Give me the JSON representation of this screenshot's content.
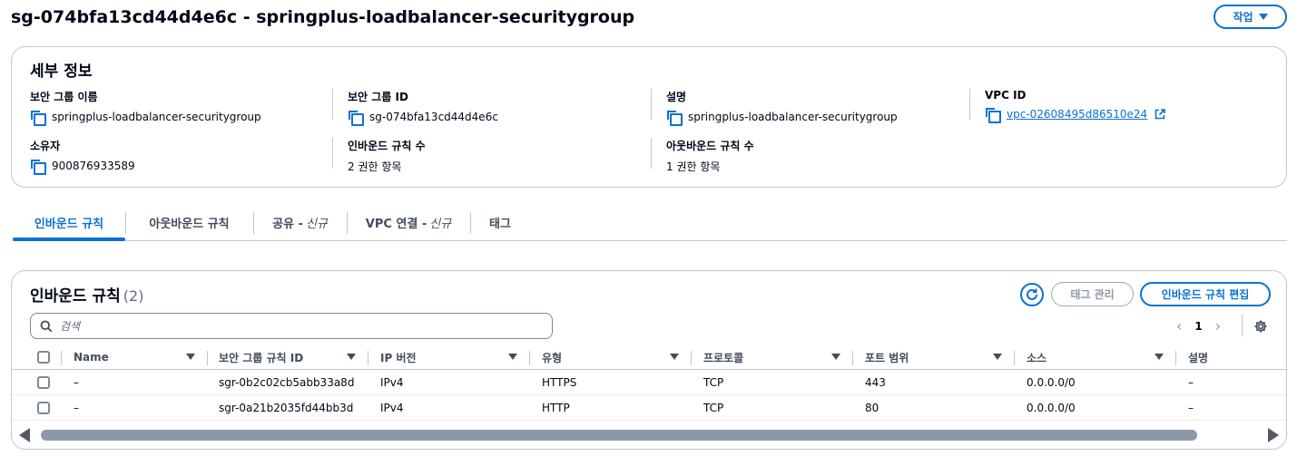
{
  "header": {
    "title": "sg-074bfa13cd44d4e6c - springplus-loadbalancer-securitygroup",
    "actions_label": "작업"
  },
  "details": {
    "title": "세부 정보",
    "security_group_name": {
      "label": "보안 그룹 이름",
      "value": "springplus-loadbalancer-securitygroup"
    },
    "security_group_id": {
      "label": "보안 그룹 ID",
      "value": "sg-074bfa13cd44d4e6c"
    },
    "description": {
      "label": "설명",
      "value": "springplus-loadbalancer-securitygroup"
    },
    "vpc_id": {
      "label": "VPC ID",
      "value": "vpc-02608495d86510e24"
    },
    "owner": {
      "label": "소유자",
      "value": "900876933589"
    },
    "inbound_count": {
      "label": "인바운드 규칙 수",
      "value": "2 권한 항목"
    },
    "outbound_count": {
      "label": "아웃바운드 규칙 수",
      "value": "1 권한 항목"
    }
  },
  "tabs": [
    {
      "label": "인바운드 규칙",
      "suffix": ""
    },
    {
      "label": "아웃바운드 규칙",
      "suffix": ""
    },
    {
      "label": "공유 -",
      "suffix": "신규"
    },
    {
      "label": "VPC 연결 -",
      "suffix": "신규"
    },
    {
      "label": "태그",
      "suffix": ""
    }
  ],
  "inbound": {
    "title": "인바운드 규칙",
    "count": "(2)",
    "manage_tags_label": "태그 관리",
    "edit_label": "인바운드 규칙 편집",
    "search_placeholder": "검색",
    "page": "1",
    "columns": [
      "Name",
      "보안 그룹 규칙 ID",
      "IP 버전",
      "유형",
      "프로토콜",
      "포트 범위",
      "소스",
      "설명"
    ],
    "rows": [
      [
        "–",
        "sgr-0b2c02cb5abb33a8d",
        "IPv4",
        "HTTPS",
        "TCP",
        "443",
        "0.0.0.0/0",
        "–"
      ],
      [
        "–",
        "sgr-0a21b2035fd44bb3d",
        "IPv4",
        "HTTP",
        "TCP",
        "80",
        "0.0.0.0/0",
        "–"
      ]
    ]
  },
  "colors": {
    "accent": "#0972d3",
    "text": "#000716",
    "border": "#c6c6cd"
  }
}
